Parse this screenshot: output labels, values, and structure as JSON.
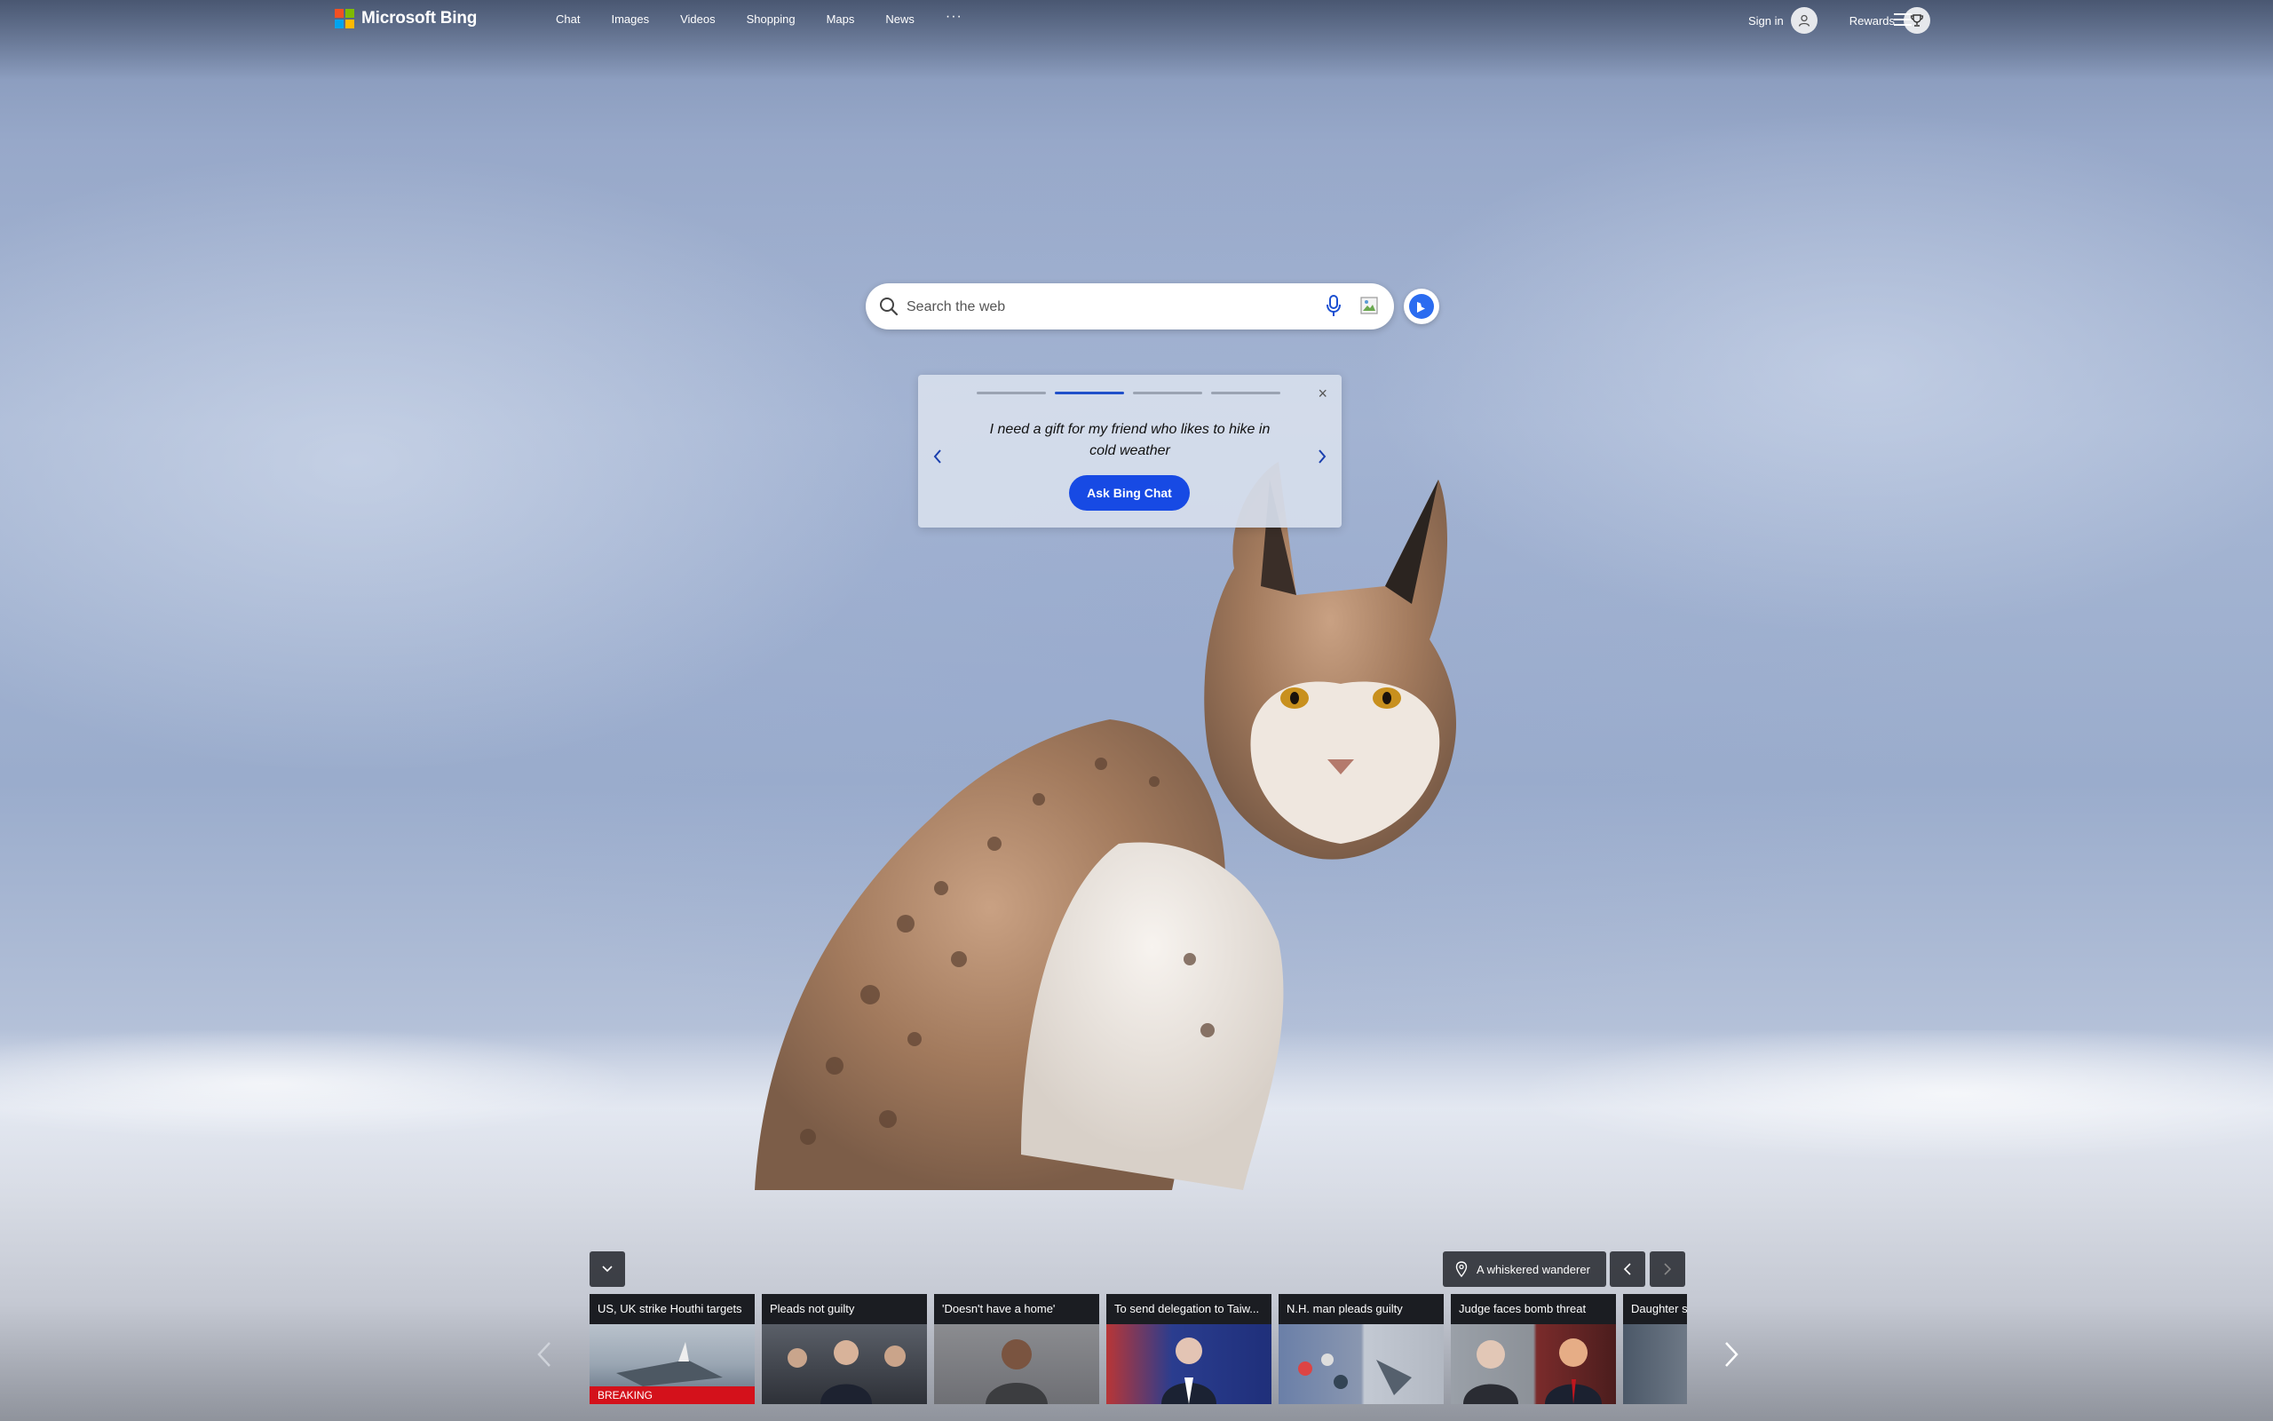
{
  "brand": {
    "name": "Microsoft Bing",
    "colors": [
      "#f25022",
      "#7fba00",
      "#00a4ef",
      "#ffb900"
    ]
  },
  "nav": {
    "items": [
      {
        "label": "Chat"
      },
      {
        "label": "Images"
      },
      {
        "label": "Videos"
      },
      {
        "label": "Shopping"
      },
      {
        "label": "Maps"
      },
      {
        "label": "News"
      }
    ],
    "more": "···"
  },
  "header": {
    "sign_in": "Sign in",
    "rewards": "Rewards"
  },
  "search": {
    "placeholder": "Search the web",
    "value": ""
  },
  "suggestion": {
    "prompt": "I need a gift for my friend who likes to hike in cold weather",
    "button": "Ask Bing Chat",
    "close": "×",
    "page_count": 4,
    "active_page": 2,
    "accent": "#174ae4"
  },
  "image_info": {
    "label": "A whiskered wanderer"
  },
  "news": [
    {
      "title": "US, UK strike Houthi targets",
      "badge": "BREAKING"
    },
    {
      "title": "Pleads not guilty"
    },
    {
      "title": "'Doesn't have a home'"
    },
    {
      "title": "To send delegation to Taiw..."
    },
    {
      "title": "N.H. man pleads guilty"
    },
    {
      "title": "Judge faces bomb threat"
    },
    {
      "title": "Daughter s"
    }
  ]
}
